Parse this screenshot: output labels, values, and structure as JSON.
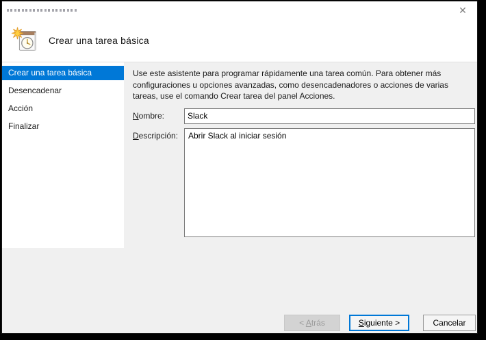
{
  "window": {
    "icons": {
      "close": "✕"
    }
  },
  "header": {
    "title": "Crear una tarea básica",
    "icon": "scheduled-task-new-icon"
  },
  "sidebar": {
    "items": [
      {
        "label": "Crear una tarea básica",
        "selected": true
      },
      {
        "label": "Desencadenar",
        "selected": false
      },
      {
        "label": "Acción",
        "selected": false
      },
      {
        "label": "Finalizar",
        "selected": false
      }
    ]
  },
  "content": {
    "intro": "Use este asistente para programar rápidamente una tarea común. Para obtener más configuraciones u opciones avanzadas, como desencadenadores o acciones de varias tareas, use el comando Crear tarea del panel Acciones.",
    "name_label": {
      "key": "N",
      "rest": "ombre:"
    },
    "name_value": "Slack",
    "desc_label": {
      "key": "D",
      "rest": "escripción:"
    },
    "desc_value": "Abrir Slack al iniciar sesión"
  },
  "buttons": {
    "back": {
      "prefix": "< ",
      "key": "A",
      "rest": "trás"
    },
    "next": {
      "key": "S",
      "rest": "iguiente >"
    },
    "cancel": "Cancelar"
  },
  "colors": {
    "accent": "#0078d7",
    "content_background": "#f0f0f0",
    "selected_text": "#ffffff"
  }
}
